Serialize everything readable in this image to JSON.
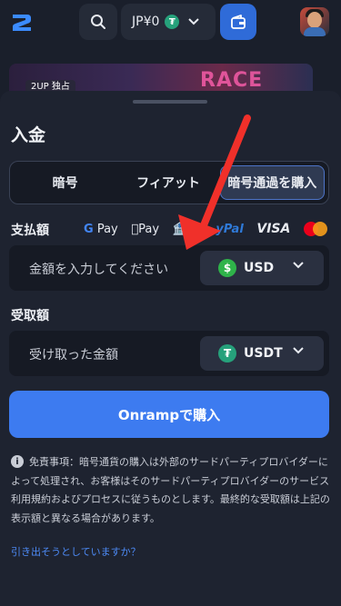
{
  "header": {
    "balance_label": "JP¥0",
    "balance_currency_symbol": "₮"
  },
  "banner": {
    "badge": "2UP 独占",
    "title": "RACE"
  },
  "sheet": {
    "title": "入金",
    "tabs": [
      {
        "label": "暗号",
        "active": false
      },
      {
        "label": "フィアット",
        "active": false
      },
      {
        "label": "暗号通過を購入",
        "active": true
      }
    ],
    "pay_label": "支払額",
    "pay_methods": {
      "gpay": "Pay",
      "applepay": "Pay",
      "bank": "Ba",
      "paypal": "yPal",
      "visa": "VISA"
    },
    "pay_placeholder": "金額を入力してください",
    "pay_currency": "USD",
    "pay_currency_symbol": "$",
    "receive_label": "受取額",
    "receive_placeholder": "受け取った金額",
    "receive_currency": "USDT",
    "receive_currency_symbol": "₮",
    "buy_button": "Onrampで購入",
    "disclaimer": "免責事項：暗号通貨の購入は外部のサードパーティプロバイダーによって処理され、お客様はそのサードパーティプロバイダーのサービス利用規約およびプロセスに従うものとします。最終的な受取額は上記の表示額と異なる場合があります。",
    "withdraw_link": "引き出そうとしていますか？"
  },
  "colors": {
    "accent": "#3d7bf0",
    "background": "#1a1f2b",
    "sheet": "#1e2330",
    "annotation_arrow": "#f0302a"
  }
}
